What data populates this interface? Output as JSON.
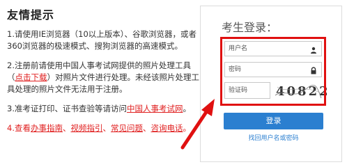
{
  "tips": {
    "title": "友情提示",
    "item1": "1.请使用IE浏览器（10以上版本）、谷歌浏览器，或者360浏览器的极速模式、搜狗浏览器的高速模式。",
    "item2_before": "2.注册前请使用中国人事考试网提供的照片处理工具（",
    "item2_link": "点击下载",
    "item2_after": "）对照片文件进行处理。未经该照片处理工具处理的照片文件无法用于注册。",
    "item3_before": "3.准考证打印、证书查验等请访问",
    "item3_link": "中国人事考试网",
    "item3_after": "。",
    "item4_prefix": "4.查看",
    "item4_links": [
      "办事指南",
      "视频指引",
      "常见问题",
      "咨询电话"
    ],
    "item4_separator": "、",
    "item4_suffix": "。"
  },
  "login": {
    "title": "考生登录：",
    "username_placeholder": "用户名",
    "password_placeholder": "密码",
    "captcha_placeholder": "验证码",
    "captcha_code": "40822",
    "login_button": "登录",
    "forgot_link": "找回用户名或密码"
  },
  "colors": {
    "accent_blue": "#2b7fd0",
    "highlight_red": "#e01010",
    "link_red": "#e02020"
  },
  "icons": {
    "username": "user-icon",
    "password": "lock-icon",
    "annotation": "red-arrow"
  }
}
